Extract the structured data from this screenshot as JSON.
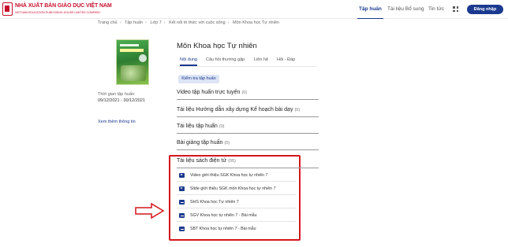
{
  "header": {
    "logo_title": "NHÀ XUẤT BẢN GIÁO DỤC VIỆT NAM",
    "logo_subtitle": "VIETNAM EDUCATION PUBLISHING HOUSE LIMITED COMPANY",
    "nav": [
      {
        "label": "Tập huấn",
        "active": true
      },
      {
        "label": "Tài liệu Bổ sung",
        "active": false
      },
      {
        "label": "Tin tức",
        "active": false
      }
    ],
    "login_label": "Đăng nhập"
  },
  "breadcrumb": [
    "Trang chủ",
    "Tập huấn",
    "Lớp 7",
    "Kết nối tri thức với cuộc sống",
    "Môn Khoa học Tự nhiên"
  ],
  "sidebar": {
    "time_label": "Thời gian tập huấn:",
    "time_value": "09/12/2021 - 30/12/2021",
    "more_info": "Xem thêm thông tin"
  },
  "main": {
    "title": "Môn Khoa học Tự nhiên",
    "tabs": [
      {
        "label": "Nội dung",
        "active": true
      },
      {
        "label": "Câu hỏi thường gặp",
        "active": false
      },
      {
        "label": "Liên hệ",
        "active": false
      },
      {
        "label": "Hỏi - Đáp",
        "active": false
      }
    ],
    "test_button": "Kiểm tra tập huấn",
    "sections": [
      {
        "title": "Video tập huấn trực tuyến",
        "count": "(0)"
      },
      {
        "title": "Tài liệu Hướng dẫn xây dựng Kế hoạch bài dạy",
        "count": "(0)"
      },
      {
        "title": "Tài liệu tập huấn",
        "count": "(0)"
      },
      {
        "title": "Bài giảng tập huấn",
        "count": "(0)"
      },
      {
        "title": "Tài liệu sách điện tử",
        "count": "(05)"
      }
    ],
    "ebook_items": [
      {
        "label": "Video giới thiệu SGK Khoa học tự nhiên 7",
        "icon": "video-icon"
      },
      {
        "label": "Slide giới thiệu SGK môn Khoa học tự nhiên 7",
        "icon": "video-icon"
      },
      {
        "label": "SHS Khoa học Tự nhiên 7",
        "icon": "book-icon"
      },
      {
        "label": "SGV Khoa học tự nhiên 7 - Bài mẫu",
        "icon": "book-icon"
      },
      {
        "label": "SBT Khoa học tự nhiên 7 - Bài mẫu",
        "icon": "book-icon"
      }
    ]
  },
  "colors": {
    "brand_red": "#c8102e",
    "primary_blue": "#1b3a8f",
    "annotation_red": "#d4171c"
  }
}
